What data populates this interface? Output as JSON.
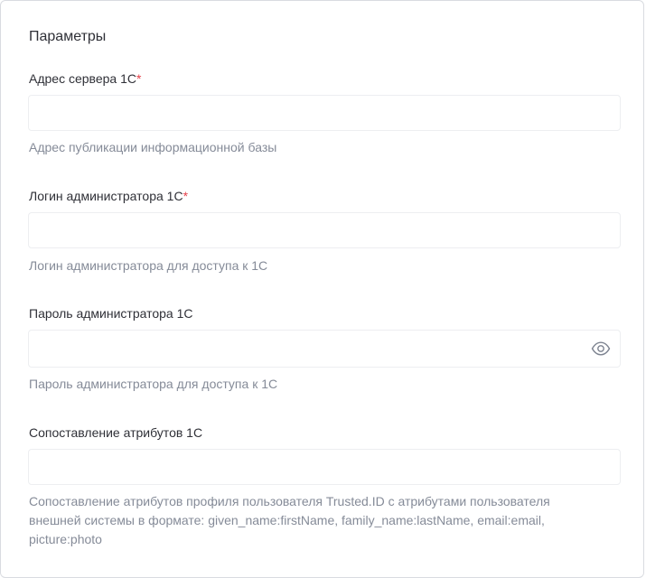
{
  "section": {
    "title": "Параметры"
  },
  "fields": [
    {
      "label": "Адрес сервера 1С",
      "required_mark": "*",
      "value": "",
      "helper": "Адрес публикации информационной базы"
    },
    {
      "label": "Логин администратора 1С",
      "required_mark": "*",
      "value": "",
      "helper": "Логин администратора для доступа к 1С"
    },
    {
      "label": "Пароль администратора 1С",
      "value": "",
      "toggle_icon": "eye-icon",
      "helper": "Пароль администратора для доступа к 1С"
    },
    {
      "label": "Сопоставление атрибутов 1С",
      "value": "",
      "helper": "Сопоставление атрибутов профиля пользователя Trusted.ID с атрибутами пользователя внешней системы в формате: given_name:firstName, family_name:lastName, email:email, picture:photo"
    }
  ],
  "colors": {
    "required": "#e5404a",
    "label": "#2f3037",
    "helper": "#858b98",
    "border": "#edeef1"
  }
}
